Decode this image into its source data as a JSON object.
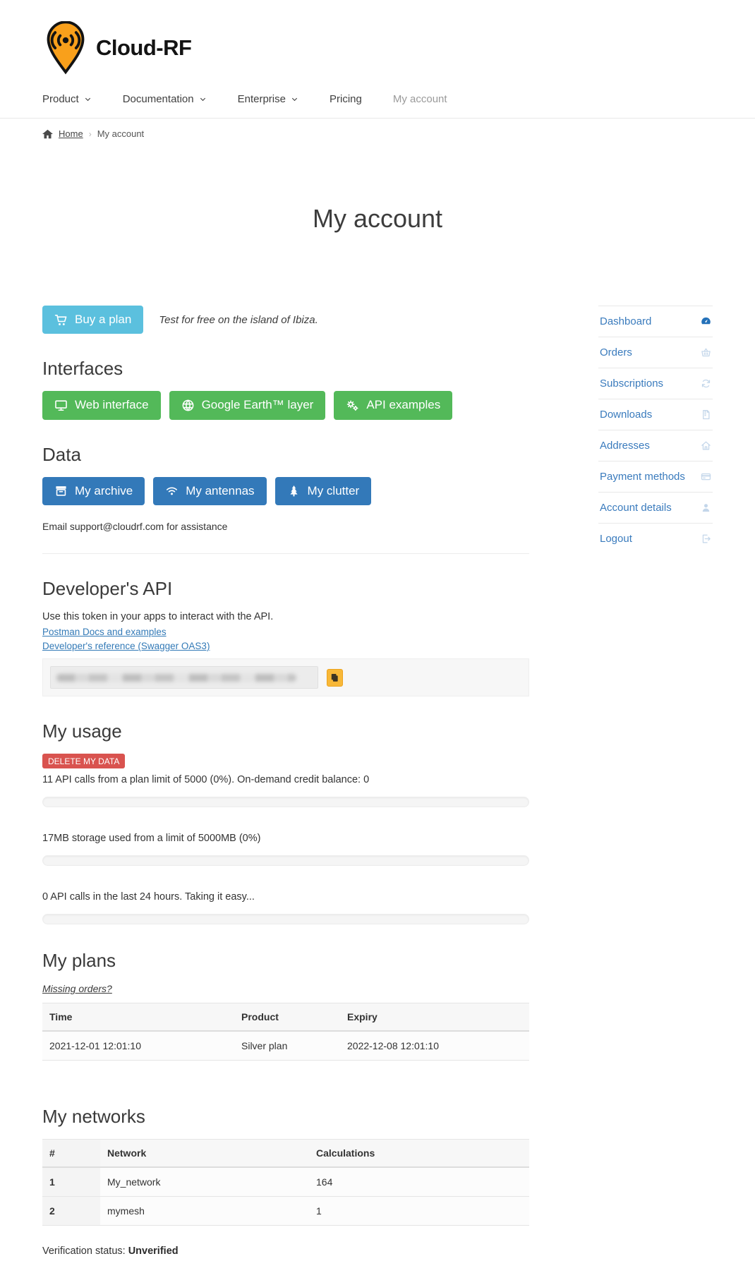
{
  "brand": {
    "name": "Cloud-RF"
  },
  "nav": {
    "items": [
      {
        "label": "Product",
        "dropdown": true
      },
      {
        "label": "Documentation",
        "dropdown": true
      },
      {
        "label": "Enterprise",
        "dropdown": true
      },
      {
        "label": "Pricing",
        "dropdown": false
      },
      {
        "label": "My account",
        "dropdown": false
      }
    ]
  },
  "breadcrumb": {
    "home": "Home",
    "current": "My account"
  },
  "page": {
    "title": "My account"
  },
  "buy": {
    "button_label": "Buy a plan",
    "note": "Test for free on the island of Ibiza."
  },
  "interfaces": {
    "heading": "Interfaces",
    "buttons": [
      {
        "label": "Web interface",
        "icon": "monitor-icon"
      },
      {
        "label": "Google Earth™ layer",
        "icon": "globe-icon"
      },
      {
        "label": "API examples",
        "icon": "gears-icon"
      }
    ]
  },
  "data_section": {
    "heading": "Data",
    "buttons": [
      {
        "label": "My archive",
        "icon": "archive-icon"
      },
      {
        "label": "My antennas",
        "icon": "wifi-icon"
      },
      {
        "label": "My clutter",
        "icon": "tree-icon"
      }
    ],
    "support": "Email support@cloudrf.com for assistance"
  },
  "developer": {
    "heading": "Developer's API",
    "intro": "Use this token in your apps to interact with the API.",
    "links": [
      "Postman Docs and examples",
      "Developer's reference (Swagger OAS3)"
    ]
  },
  "usage": {
    "heading": "My usage",
    "delete_button": "DELETE MY DATA",
    "lines": [
      "11 API calls from a plan limit of 5000 (0%). On-demand credit balance: 0",
      "17MB storage used from a limit of 5000MB (0%)",
      "0 API calls in the last 24 hours. Taking it easy..."
    ],
    "progress_values": [
      0,
      0,
      0
    ]
  },
  "plans": {
    "heading": "My plans",
    "missing_link": "Missing orders?",
    "columns": [
      "Time",
      "Product",
      "Expiry"
    ],
    "rows": [
      [
        "2021-12-01 12:01:10",
        "Silver plan",
        "2022-12-08 12:01:10"
      ]
    ]
  },
  "networks": {
    "heading": "My networks",
    "columns": [
      "#",
      "Network",
      "Calculations"
    ],
    "rows": [
      [
        "1",
        "My_network",
        "164"
      ],
      [
        "2",
        "mymesh",
        "1"
      ]
    ]
  },
  "verification": {
    "label": "Verification status: ",
    "status": "Unverified"
  },
  "sidebar": {
    "items": [
      {
        "label": "Dashboard",
        "icon": "dashboard-icon",
        "active": true
      },
      {
        "label": "Orders",
        "icon": "basket-icon",
        "active": false
      },
      {
        "label": "Subscriptions",
        "icon": "sync-icon",
        "active": false
      },
      {
        "label": "Downloads",
        "icon": "zip-file-icon",
        "active": false
      },
      {
        "label": "Addresses",
        "icon": "home-icon",
        "active": false
      },
      {
        "label": "Payment methods",
        "icon": "credit-card-icon",
        "active": false
      },
      {
        "label": "Account details",
        "icon": "user-icon",
        "active": false
      },
      {
        "label": "Logout",
        "icon": "logout-icon",
        "active": false
      }
    ]
  },
  "colors": {
    "brand_orange": "#f9a01b",
    "buy_button": "#5bc0de",
    "success_button": "#53b959",
    "primary_button": "#3379b9",
    "danger_badge": "#d9534f",
    "copy_button": "#f8b838",
    "link_blue": "#337ab7"
  }
}
